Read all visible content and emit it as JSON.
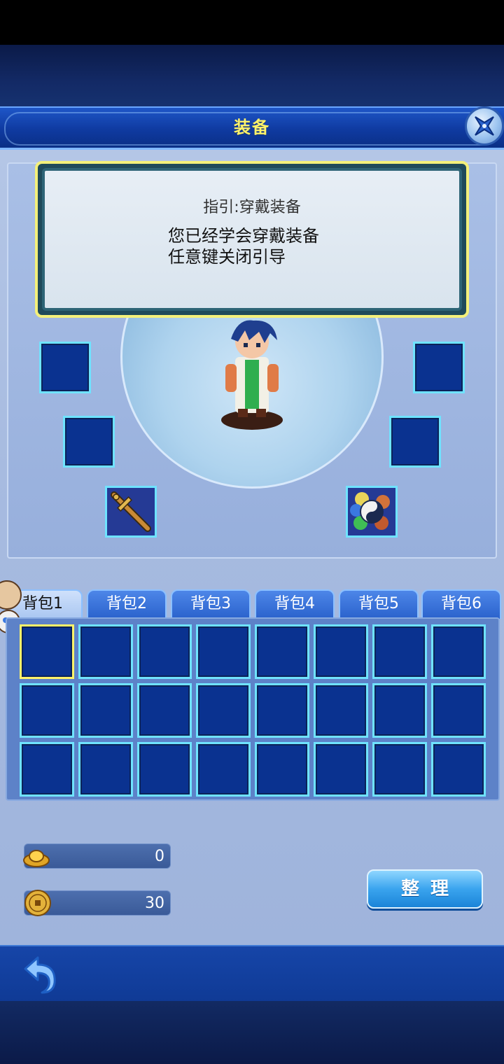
{
  "title_bar": {
    "title": "装备"
  },
  "guide": {
    "title": "指引:穿戴装备",
    "line1": "您已经学会穿戴装备",
    "line2": "任意键关闭引导"
  },
  "equipment": {
    "weapon_icon": "sword-icon",
    "accessory_icon": "taiji-orb-icon"
  },
  "bag": {
    "tabs": [
      {
        "label": "背包1",
        "active": true
      },
      {
        "label": "背包2",
        "active": false
      },
      {
        "label": "背包3",
        "active": false
      },
      {
        "label": "背包4",
        "active": false
      },
      {
        "label": "背包5",
        "active": false
      },
      {
        "label": "背包6",
        "active": false
      }
    ],
    "rows": 3,
    "cols": 8,
    "selected_slot": 0
  },
  "currency": {
    "gold_ingot": {
      "icon": "gold-ingot-icon",
      "value": "0"
    },
    "copper_coin": {
      "icon": "copper-coin-icon",
      "value": "30"
    }
  },
  "actions": {
    "sort_label": "整理"
  },
  "colors": {
    "accent_yellow": "#fff36a",
    "slot_blue": "#0a3290",
    "slot_border": "#6fe3ff"
  }
}
